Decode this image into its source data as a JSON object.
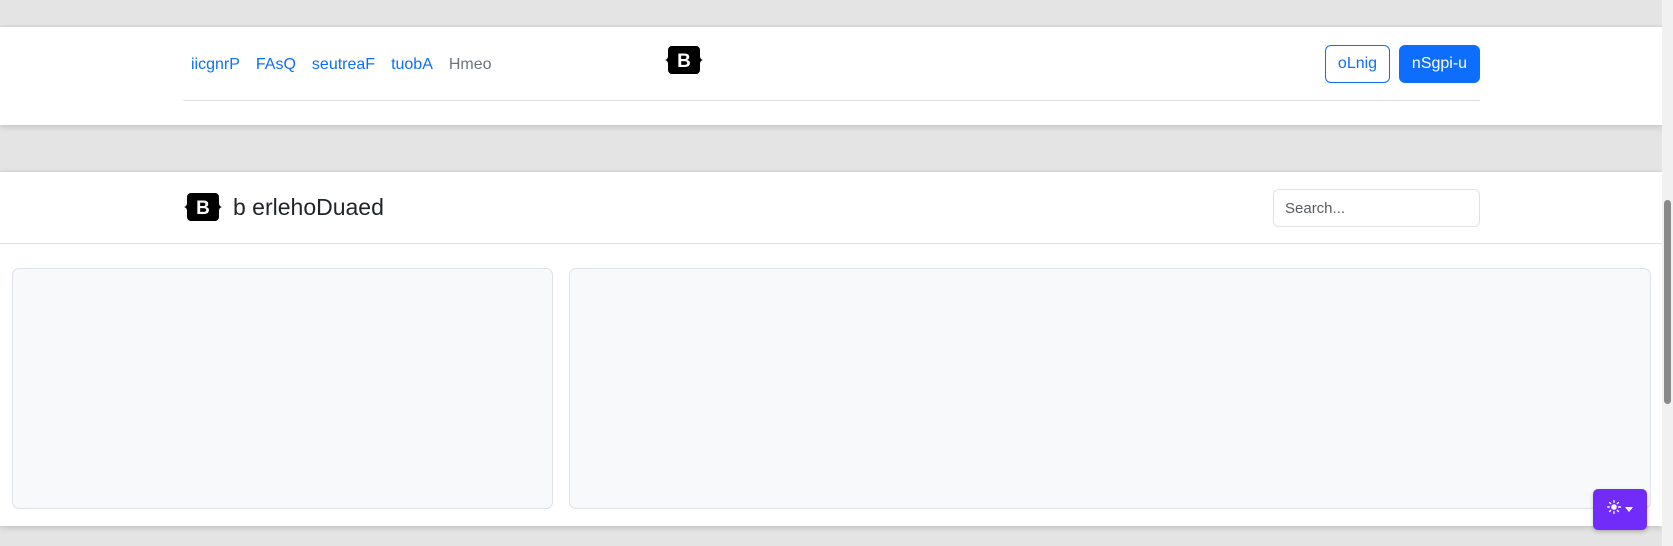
{
  "header1": {
    "nav_links": [
      {
        "label": "iicgnrP"
      },
      {
        "label": "FAsQ"
      },
      {
        "label": "seutreaF"
      },
      {
        "label": "tuobA"
      },
      {
        "label": "Hmeo"
      }
    ],
    "login_label": "oLnig",
    "signup_label": "nSgpi-u"
  },
  "dashboard": {
    "brand_letter": "B",
    "brand_title": "b erlehoDuaed",
    "search_placeholder": "Search..."
  },
  "logo_letter": "B",
  "theme_toggle": {
    "icon": "sun-icon"
  },
  "colors": {
    "primary": "#0d6efd",
    "theme_accent": "#712cf9",
    "panel_bg": "#f8f9fa"
  }
}
